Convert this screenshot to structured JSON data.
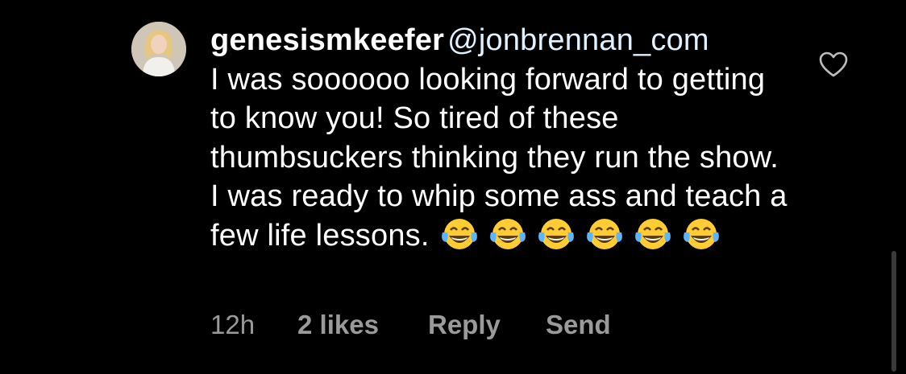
{
  "comment": {
    "username": "genesismkeefer",
    "mention": "@jonbrennan_com",
    "text": "I was soooooo looking forward to getting to know you! So tired of these thumbsuckers thinking they run the show. I was ready to whip some ass and teach a few life lessons.",
    "emojis": [
      "face-with-tears-of-joy",
      "face-with-tears-of-joy",
      "face-with-tears-of-joy",
      "face-with-tears-of-joy",
      "face-with-tears-of-joy",
      "face-with-tears-of-joy"
    ]
  },
  "meta": {
    "time": "12h",
    "likes": "2 likes",
    "reply": "Reply",
    "send": "Send"
  },
  "icons": {
    "avatar": "profile-photo",
    "like": "heart-outline-icon"
  },
  "colors": {
    "background": "#000000",
    "text": "#ffffff",
    "mention": "#e0f1ff",
    "meta": "#9a9a9a",
    "emoji_face": "#ffcc33"
  }
}
